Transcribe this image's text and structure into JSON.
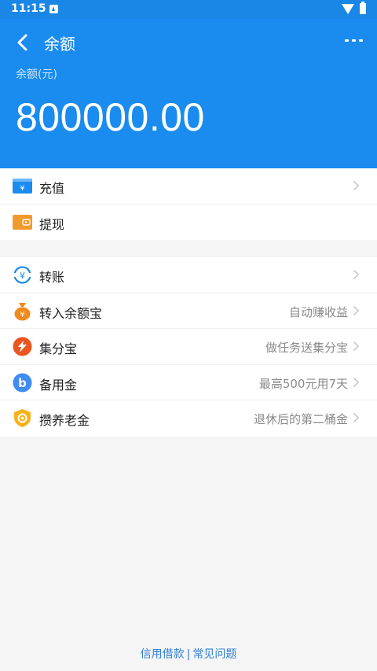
{
  "status_bar": {
    "time": "11:15"
  },
  "header": {
    "title": "余额",
    "balance_label": "余额(元)",
    "balance_amount": "800000.00"
  },
  "group1": [
    {
      "label": "充值",
      "hint": "",
      "icon": "recharge-card-icon",
      "chevron": true
    },
    {
      "label": "提现",
      "hint": "",
      "icon": "wallet-icon",
      "chevron": false
    }
  ],
  "group2": [
    {
      "label": "转账",
      "hint": "",
      "icon": "transfer-yuan-icon",
      "chevron": true
    },
    {
      "label": "转入余额宝",
      "hint": "自动赚收益",
      "icon": "money-bag-icon",
      "chevron": true
    },
    {
      "label": "集分宝",
      "hint": "做任务送集分宝",
      "icon": "jifenbao-icon",
      "chevron": true
    },
    {
      "label": "备用金",
      "hint": "最高500元用7天",
      "icon": "beiyongjin-icon",
      "chevron": true
    },
    {
      "label": "攒养老金",
      "hint": "退休后的第二桶金",
      "icon": "pension-shield-icon",
      "chevron": true
    }
  ],
  "footer": {
    "link1": "信用借款",
    "separator": "|",
    "link2": "常见问题"
  },
  "colors": {
    "primary": "#1a8cf0",
    "link": "#2f7fd8"
  }
}
